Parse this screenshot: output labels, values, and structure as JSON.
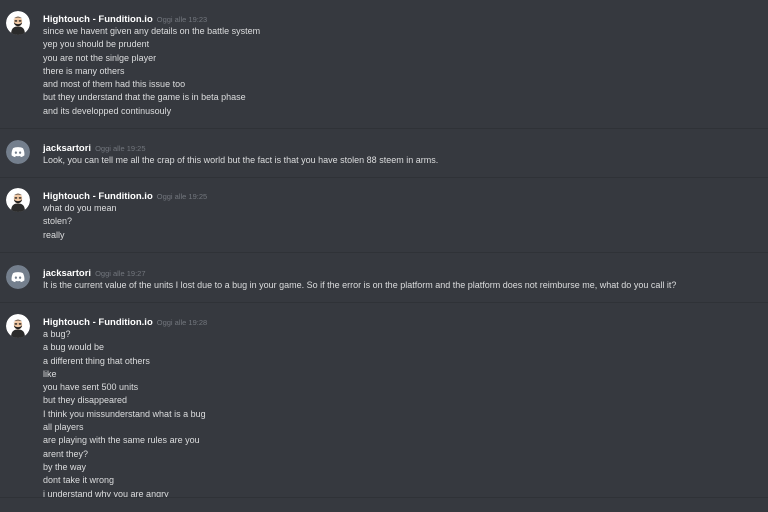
{
  "messages": [
    {
      "author": "Hightouch - Fundition.io",
      "timestamp": "Oggi alle 19:23",
      "avatar_icon": "bearded-man-avatar-icon",
      "lines": [
        "since we havent given any details on the battle system",
        "yep you should be prudent",
        "you are not the sinlge player",
        "there is many others",
        "and most of them had this issue too",
        "but they understand that the game is in beta phase",
        "and its developped continusouly"
      ]
    },
    {
      "author": "jacksartori",
      "timestamp": "Oggi alle 19:25",
      "avatar_icon": "discord-logo-avatar-icon",
      "lines": [
        "Look, you can tell me all the crap of this world but the fact is that you have stolen 88 steem in arms."
      ]
    },
    {
      "author": "Hightouch - Fundition.io",
      "timestamp": "Oggi alle 19:25",
      "avatar_icon": "bearded-man-avatar-icon",
      "lines": [
        "what do you mean",
        "stolen?",
        "really"
      ]
    },
    {
      "author": "jacksartori",
      "timestamp": "Oggi alle 19:27",
      "avatar_icon": "discord-logo-avatar-icon",
      "lines": [
        "It is the current value of the units I lost due to a bug in your game. So if the error is on the platform and the platform does not reimburse me, what do you call it?"
      ]
    },
    {
      "author": "Hightouch - Fundition.io",
      "timestamp": "Oggi alle 19:28",
      "avatar_icon": "bearded-man-avatar-icon",
      "lines": [
        "a bug?",
        "a bug would be",
        "a different thing that others",
        "like",
        "you have sent 500 units",
        "but they disappeared",
        "I think you missunderstand what is a bug",
        "all players",
        "are playing with the same rules are you",
        "arent they?",
        "by the way",
        "dont take it wrong",
        "i understand why you are angry"
      ]
    }
  ]
}
